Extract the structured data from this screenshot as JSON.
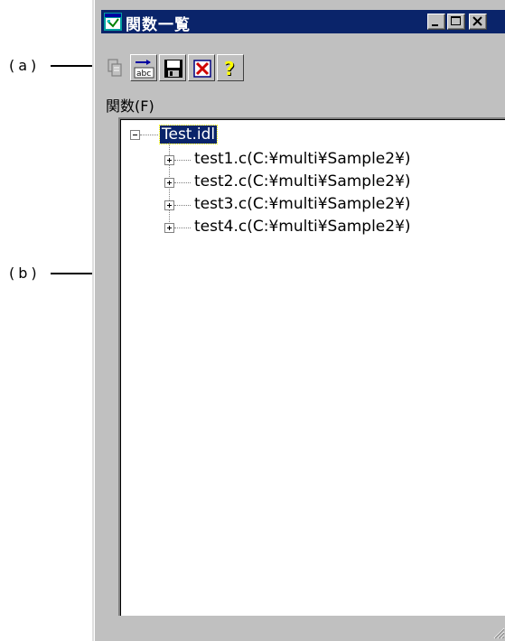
{
  "callouts": {
    "a": "(a)",
    "b": "(b)"
  },
  "window": {
    "title": "関数一覧",
    "title_icon": "window-app-icon",
    "controls": [
      "minimize-icon",
      "maximize-icon",
      "close-icon"
    ]
  },
  "toolbar": {
    "buttons": [
      {
        "name": "copy-button",
        "icon": "copy-icon",
        "enabled": false
      },
      {
        "name": "find-button",
        "icon": "abc-find-icon",
        "enabled": true
      },
      {
        "name": "save-button",
        "icon": "floppy-save-icon",
        "enabled": true
      },
      {
        "name": "delete-button",
        "icon": "delete-icon",
        "enabled": true
      },
      {
        "name": "help-button",
        "icon": "help-icon",
        "enabled": true
      }
    ]
  },
  "functions": {
    "label": "関数(F)",
    "tree": {
      "root": {
        "label": "Test.idl",
        "selected": true,
        "expanded": true
      },
      "children": [
        {
          "label": "test1.c(C:¥multi¥Sample2¥)"
        },
        {
          "label": "test2.c(C:¥multi¥Sample2¥)"
        },
        {
          "label": "test3.c(C:¥multi¥Sample2¥)"
        },
        {
          "label": "test4.c(C:¥multi¥Sample2¥)"
        }
      ]
    }
  },
  "colors": {
    "titlebar": "#0a246a",
    "window_face": "#c0c0c0",
    "selection": "#0a246a"
  }
}
